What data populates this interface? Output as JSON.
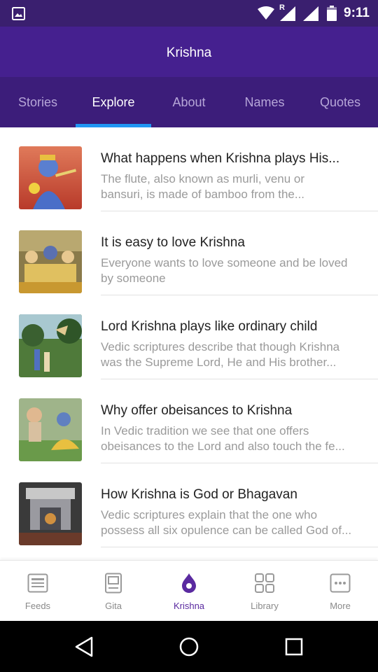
{
  "status_bar": {
    "time": "9:11",
    "roaming_indicator": "R",
    "icons": [
      "image-icon",
      "wifi-icon",
      "cell-signal-icon",
      "cell-signal-icon",
      "battery-icon"
    ]
  },
  "app_bar": {
    "title": "Krishna"
  },
  "tabs": [
    {
      "label": "Stories"
    },
    {
      "label": "Explore"
    },
    {
      "label": "About"
    },
    {
      "label": "Names"
    },
    {
      "label": "Quotes"
    }
  ],
  "active_tab": "Explore",
  "articles": [
    {
      "title": "What happens when Krishna plays His...",
      "desc_line1": "The flute, also known as murli, venu or",
      "desc_line2": "bansuri, is made of bamboo from the..."
    },
    {
      "title": "It is easy to love Krishna",
      "desc_line1": "Everyone wants to love someone and be loved",
      "desc_line2": "by someone"
    },
    {
      "title": "Lord Krishna plays like ordinary child",
      "desc_line1": "Vedic scriptures describe that though Krishna",
      "desc_line2": "was the Supreme Lord, He and His brother..."
    },
    {
      "title": "Why offer obeisances to Krishna",
      "desc_line1": "In Vedic tradition we see that one offers",
      "desc_line2": "obeisances to the Lord and also touch the fe..."
    },
    {
      "title": "How Krishna is God or Bhagavan",
      "desc_line1": "Vedic scriptures explain that the one who",
      "desc_line2": "possess all six opulence can be called God of..."
    }
  ],
  "bottom_nav": [
    {
      "label": "Feeds",
      "icon": "feeds-icon"
    },
    {
      "label": "Gita",
      "icon": "book-icon"
    },
    {
      "label": "Krishna",
      "icon": "flame-icon"
    },
    {
      "label": "Library",
      "icon": "grid-icon"
    },
    {
      "label": "More",
      "icon": "more-icon"
    }
  ],
  "active_nav": "Krishna",
  "colors": {
    "status_bar": "#3a1f6f",
    "app_bar": "#45208f",
    "tab_bar": "#3c1d7a",
    "tab_indicator": "#2196f3",
    "active_nav": "#5a2aa0"
  }
}
